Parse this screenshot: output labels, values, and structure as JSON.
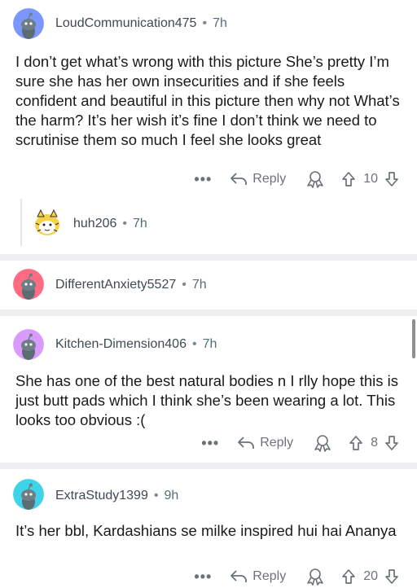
{
  "comments": [
    {
      "username": "LoudCommunication475",
      "time": "7h",
      "body": "I don’t get what’s wrong with this picture She’s pretty I’m sure she has her own insecurities and if she feels confident and beautiful in this picture then why not What’s the harm? It’s her wish it’s fine I don’t think we need to scrutinise them so much I feel she looks great",
      "reply_label": "Reply",
      "score": "10",
      "avatar_color": "#7b97ff"
    },
    {
      "username": "huh206",
      "time": "7h",
      "avatar_color": "#f6d14a"
    },
    {
      "username": "DifferentAnxiety5527",
      "time": "7h",
      "avatar_color": "#ff6b83"
    },
    {
      "username": "Kitchen-Dimension406",
      "time": "7h",
      "body": "She has one of the best natural bodies n I rlly hope this is just butt pads which I think she’s been wearing a lot. This looks too obvious :(",
      "reply_label": "Reply",
      "score": "8",
      "avatar_color": "#d99bff"
    },
    {
      "username": "ExtraStudy1399",
      "time": "9h",
      "body": "It’s her bbl, Kardashians se milke inspired hui hai Ananya",
      "reply_label": "Reply",
      "score": "20",
      "avatar_color": "#3ed3e8"
    }
  ],
  "separator_dot": "•",
  "more_label": "•••",
  "icons": {
    "reply": "reply-arrow-icon",
    "award": "award-icon",
    "upvote": "upvote-arrow-icon",
    "downvote": "downvote-arrow-icon"
  }
}
